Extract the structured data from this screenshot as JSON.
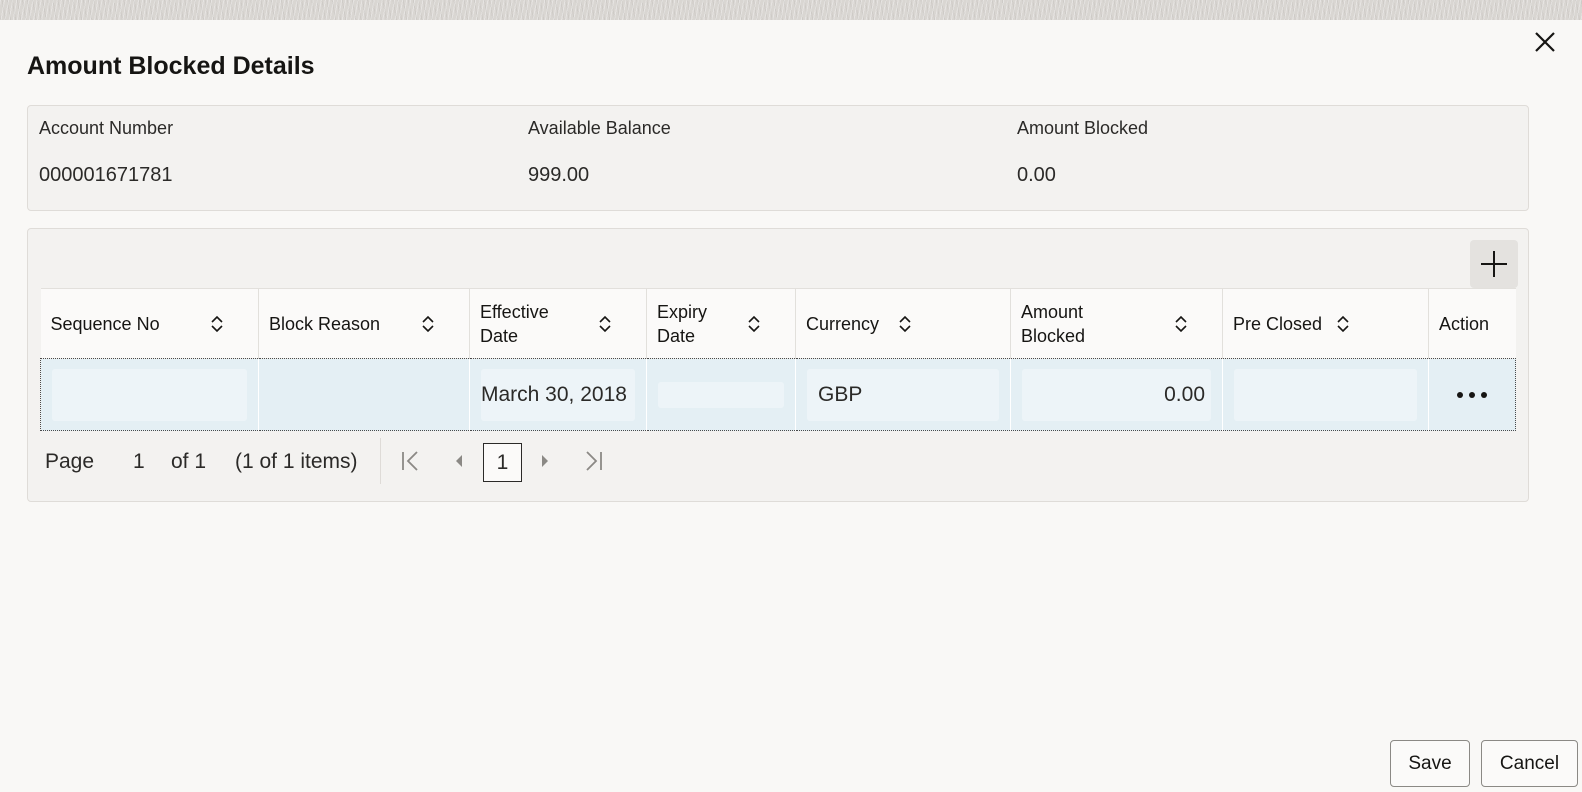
{
  "dialog": {
    "title": "Amount Blocked Details"
  },
  "summary": {
    "account_number_label": "Account Number",
    "account_number_value": "000001671781",
    "available_balance_label": "Available Balance",
    "available_balance_value": "999.00",
    "amount_blocked_label": "Amount Blocked",
    "amount_blocked_value": "0.00"
  },
  "grid": {
    "columns": [
      {
        "label": "Sequence No",
        "sortable": true
      },
      {
        "label": "Block Reason",
        "sortable": true
      },
      {
        "label": "Effective Date",
        "sortable": true
      },
      {
        "label": "Expiry Date",
        "sortable": true
      },
      {
        "label": "Currency",
        "sortable": true
      },
      {
        "label": "Amount Blocked",
        "sortable": true
      },
      {
        "label": "Pre Closed",
        "sortable": true
      },
      {
        "label": "Action",
        "sortable": false
      }
    ],
    "rows": [
      {
        "sequence_no": "",
        "block_reason": "",
        "effective_date": "March 30, 2018",
        "expiry_date": "",
        "currency": "GBP",
        "amount_blocked": "0.00",
        "pre_closed": "",
        "action_icon": "more-horizontal-icon"
      }
    ]
  },
  "pager": {
    "page_label": "Page",
    "page_value": "1",
    "of_label": "of 1",
    "items_label": "(1 of 1 items)",
    "current_page": "1"
  },
  "footer": {
    "save_label": "Save",
    "cancel_label": "Cancel"
  },
  "icons": {
    "close": "close-icon",
    "add": "plus-icon",
    "sort": "sort-icon",
    "first": "first-page-icon",
    "prev": "previous-page-icon",
    "next": "next-page-icon",
    "last": "last-page-icon"
  }
}
